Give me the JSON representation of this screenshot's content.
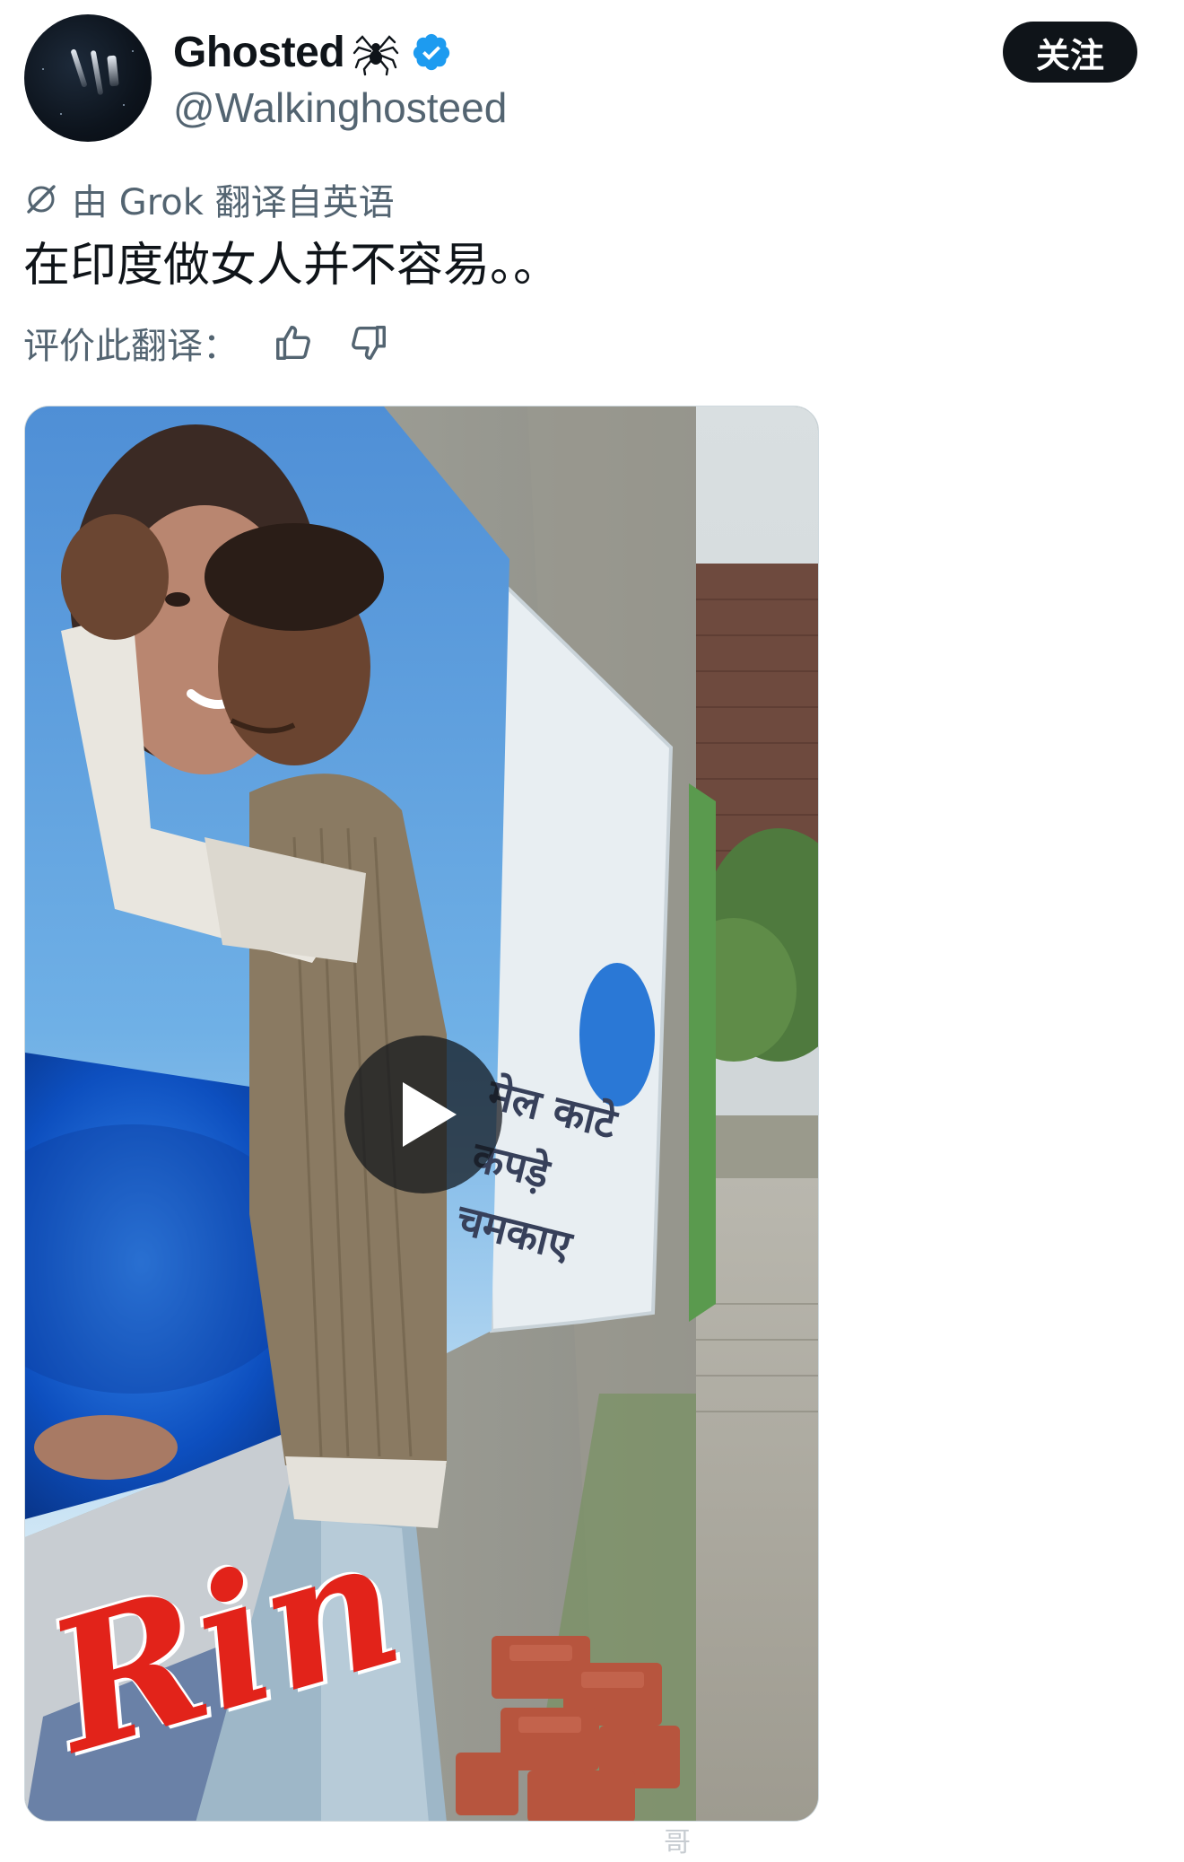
{
  "post": {
    "author": {
      "display_name": "Ghosted",
      "handle": "@Walkinghosteed",
      "verified": true,
      "name_emoji": "spider-icon"
    },
    "follow_label": "关注",
    "translation": {
      "translated_by": "由 Grok 翻译自英语",
      "text": "在印度做女人并不容易。。",
      "rate_label": "评价此翻译："
    }
  },
  "media": {
    "type": "video",
    "poster_text": {
      "brand": "Rin",
      "slogan": "मेल काटे\nकपड़े चमकाए"
    }
  },
  "watermark": "哥",
  "colors": {
    "text_primary": "#0f1419",
    "text_secondary": "#536471",
    "verified_blue": "#1d9bf0",
    "follow_bg": "#0f1419"
  }
}
